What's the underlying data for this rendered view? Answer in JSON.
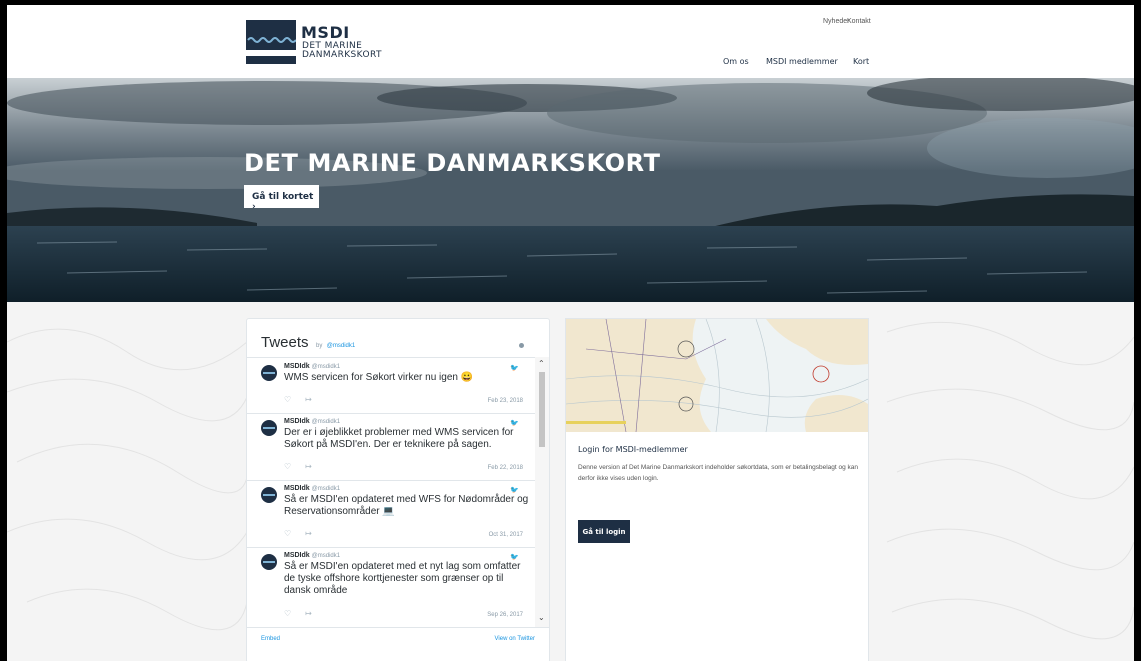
{
  "header": {
    "logo": {
      "title": "MSDI",
      "subtitle_line1": "DET MARINE",
      "subtitle_line2": "DANMARKSKORT"
    },
    "top_links": [
      "Nyheder",
      "Kontakt"
    ],
    "main_nav": [
      "Om os",
      "MSDI medlemmer",
      "Kort"
    ]
  },
  "hero": {
    "title": "DET MARINE DANMARKSKORT",
    "button_label": "Gå til kortet ›"
  },
  "tweets": {
    "title": "Tweets",
    "by": "by",
    "handle": "@msdidk1",
    "items": [
      {
        "name": "MSDIdk",
        "handle": "@msdidk1",
        "text": "WMS servicen for Søkort virker nu igen 😀",
        "date": "Feb 23, 2018"
      },
      {
        "name": "MSDIdk",
        "handle": "@msdidk1",
        "text": "Der er i øjeblikket problemer med WMS servicen for Søkort på MSDI'en. Der er teknikere på sagen.",
        "date": "Feb 22, 2018"
      },
      {
        "name": "MSDIdk",
        "handle": "@msdidk1",
        "text": "Så er MSDI'en opdateret med WFS for Nødområder og Reservationsområder 💻",
        "date": "Oct 31, 2017"
      },
      {
        "name": "MSDIdk",
        "handle": "@msdidk1",
        "text": "Så er MSDI'en opdateret med et nyt lag som omfatter de tyske offshore korttjenester som grænser op til dansk område",
        "date": "Sep 26, 2017"
      }
    ],
    "footer_embed": "Embed",
    "footer_view": "View on Twitter"
  },
  "login_card": {
    "title": "Login for MSDI-medlemmer",
    "description": "Denne version af Det Marine Danmarkskort indeholder søkortdata, som er betalingsbelagt og kan derfor ikke vises uden login.",
    "button_label": "Gå til login"
  },
  "colors": {
    "brand_navy": "#1e2f44",
    "twitter_blue": "#1b95e0"
  }
}
